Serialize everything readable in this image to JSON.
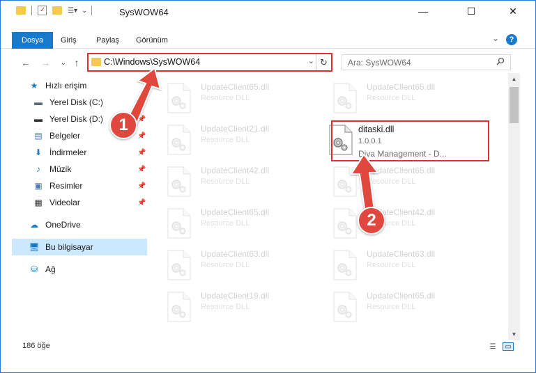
{
  "window": {
    "title": "SysWOW64",
    "buttons": {
      "minimize": "—",
      "maximize": "☐",
      "close": "✕"
    }
  },
  "ribbon": {
    "tabs": [
      "Dosya",
      "Giriş",
      "Paylaş",
      "Görünüm"
    ],
    "collapse": "⌄",
    "help": "?"
  },
  "nav": {
    "back": "←",
    "forward": "→",
    "recent": "⌄",
    "up": "↑",
    "address_path": "C:\\Windows\\SysWOW64",
    "address_dropdown": "⌄",
    "refresh": "↻",
    "search_placeholder": "Ara: SysWOW64",
    "search_icon": "🔍"
  },
  "sidebar": {
    "items": [
      {
        "label": "Hızlı erişim",
        "icon": "star-icon",
        "glyph": "★",
        "color": "#1979ca"
      },
      {
        "label": "Yerel Disk (C:)",
        "icon": "drive-icon",
        "glyph": "▬",
        "color": "#5a6a7a",
        "pinned": "📌"
      },
      {
        "label": "Yerel Disk (D:)",
        "icon": "drive-icon",
        "glyph": "▬",
        "color": "#333333",
        "pinned": "📌"
      },
      {
        "label": "Belgeler",
        "icon": "document-icon",
        "glyph": "▤",
        "color": "#4a7ab8",
        "pinned": "📌"
      },
      {
        "label": "İndirmeler",
        "icon": "download-icon",
        "glyph": "⬇",
        "color": "#1979ca",
        "pinned": "📌"
      },
      {
        "label": "Müzik",
        "icon": "music-icon",
        "glyph": "♪",
        "color": "#1979ca",
        "pinned": "📌"
      },
      {
        "label": "Resimler",
        "icon": "pictures-icon",
        "glyph": "▣",
        "color": "#4a7ab8",
        "pinned": "📌"
      },
      {
        "label": "Videolar",
        "icon": "video-icon",
        "glyph": "▦",
        "color": "#333333",
        "pinned": "📌"
      },
      {
        "label": "OneDrive",
        "icon": "cloud-icon",
        "glyph": "☁",
        "color": "#1979ca"
      },
      {
        "label": "Bu bilgisayar",
        "icon": "computer-icon",
        "glyph": "🖥",
        "color": "#1979ca",
        "selected": true
      },
      {
        "label": "Ağ",
        "icon": "network-icon",
        "glyph": "⛁",
        "color": "#1979ca"
      }
    ]
  },
  "files": {
    "left": [
      {
        "name": "UpdateClient65.dll",
        "desc": "Resource DLL"
      },
      {
        "name": "UpdateClient21.dll",
        "desc": "Resource DLL"
      },
      {
        "name": "UpdateClient42.dll",
        "desc": "Resource DLL"
      },
      {
        "name": "UpdateClient65.dll",
        "desc": "Resource DLL"
      },
      {
        "name": "UpdateClient63.dll",
        "desc": "Resource DLL"
      },
      {
        "name": "UpdateClient19.dll",
        "desc": "Resource DLL"
      }
    ],
    "right": [
      {
        "name": "UpdateClient65.dll",
        "desc": "Resource DLL"
      },
      {
        "name": "ditaski.dll",
        "version": "1.0.0.1",
        "company": "Diva Management - D...",
        "highlighted": true
      },
      {
        "name": "UpdateClient65.dll",
        "desc": "Resource DLL"
      },
      {
        "name": "UpdateClient42.dll",
        "desc": "Resource DLL"
      },
      {
        "name": "UpdateClient63.dll",
        "desc": "Resource DLL"
      },
      {
        "name": "UpdateClient65.dll",
        "desc": "Resource DLL"
      }
    ]
  },
  "status": {
    "count": "186 öğe",
    "details_view": "☰",
    "tiles_view": "▭"
  },
  "callouts": [
    {
      "number": "1",
      "color": "#e0473e"
    },
    {
      "number": "2",
      "color": "#e0473e"
    }
  ],
  "colors": {
    "accent": "#1979ca",
    "highlight_border": "#e0312f",
    "selection": "#cce8ff"
  }
}
